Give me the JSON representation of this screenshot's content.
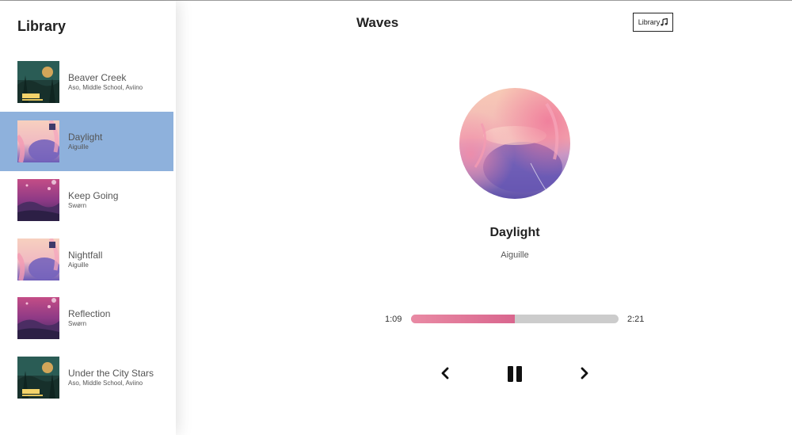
{
  "app": {
    "title": "Waves"
  },
  "header": {
    "library_button_label": "Library",
    "library_icon": "music-note-icon"
  },
  "sidebar": {
    "title": "Library",
    "songs": [
      {
        "name": "Beaver Creek",
        "artist": "Aso, Middle School, Aviino",
        "active": false,
        "art": "forest-green"
      },
      {
        "name": "Daylight",
        "artist": "Aiguille",
        "active": true,
        "art": "pink-blue"
      },
      {
        "name": "Keep Going",
        "artist": "Swørn",
        "active": false,
        "art": "purple-dusk"
      },
      {
        "name": "Nightfall",
        "artist": "Aiguille",
        "active": false,
        "art": "pink-blue"
      },
      {
        "name": "Reflection",
        "artist": "Swørn",
        "active": false,
        "art": "purple-dusk"
      },
      {
        "name": "Under the City Stars",
        "artist": "Aso, Middle School, Aviino",
        "active": false,
        "art": "forest-green"
      }
    ]
  },
  "player": {
    "title": "Daylight",
    "artist": "Aiguille",
    "current_time": "1:09",
    "duration": "2:21",
    "progress_fraction": 0.5,
    "controls": {
      "prev_icon": "chevron-left-icon",
      "play_icon": "pause-icon",
      "next_icon": "chevron-right-icon"
    }
  },
  "colors": {
    "active_row": "#8eb1dc",
    "progress_fill": "#e0789a",
    "progress_track": "#cccccc"
  }
}
